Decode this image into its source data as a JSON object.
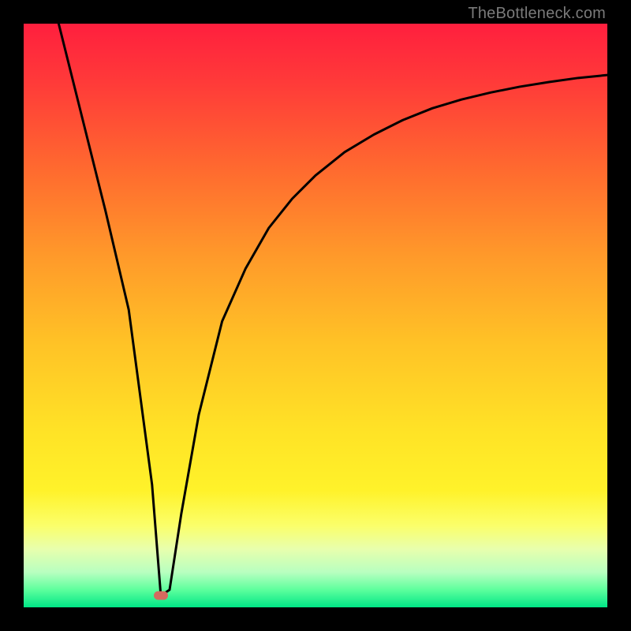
{
  "watermark": "TheBottleneck.com",
  "colors": {
    "frame_bg": "#000000",
    "curve": "#000000",
    "marker": "#d46a5f",
    "gradient_stops": [
      {
        "offset": 0.0,
        "color": "#ff1f3e"
      },
      {
        "offset": 0.1,
        "color": "#ff3a39"
      },
      {
        "offset": 0.25,
        "color": "#ff6a2f"
      },
      {
        "offset": 0.4,
        "color": "#ff9a2a"
      },
      {
        "offset": 0.55,
        "color": "#ffc326"
      },
      {
        "offset": 0.7,
        "color": "#ffe326"
      },
      {
        "offset": 0.8,
        "color": "#fff22a"
      },
      {
        "offset": 0.86,
        "color": "#fbff6a"
      },
      {
        "offset": 0.9,
        "color": "#e8ffad"
      },
      {
        "offset": 0.94,
        "color": "#b8ffc0"
      },
      {
        "offset": 0.97,
        "color": "#5dff9d"
      },
      {
        "offset": 1.0,
        "color": "#00e686"
      }
    ]
  },
  "chart_data": {
    "type": "line",
    "title": "",
    "xlabel": "",
    "ylabel": "",
    "xlim": [
      0,
      100
    ],
    "ylim": [
      0,
      100
    ],
    "grid": false,
    "legend": false,
    "series": [
      {
        "name": "curve",
        "x": [
          6,
          10,
          14,
          18,
          22,
          23.5,
          25,
          27,
          30,
          34,
          38,
          42,
          46,
          50,
          55,
          60,
          65,
          70,
          75,
          80,
          85,
          90,
          95,
          100
        ],
        "y": [
          100,
          84,
          68,
          51,
          21,
          2,
          3,
          16,
          33,
          49,
          58,
          65,
          70,
          74,
          78,
          81,
          83.5,
          85.5,
          87,
          88.2,
          89.2,
          90,
          90.7,
          91.2
        ]
      }
    ],
    "minimum_marker": {
      "x": 23.5,
      "y": 2
    },
    "notes": "V-shaped bottleneck curve. x-axis is relative component score (0–100), y-axis is bottleneck percentage (0–100). Minimum (~2%) around x≈23.5. Left branch is nearly linear from (6,100) to the minimum; right branch rises steeply then asymptotes toward ~91%."
  }
}
